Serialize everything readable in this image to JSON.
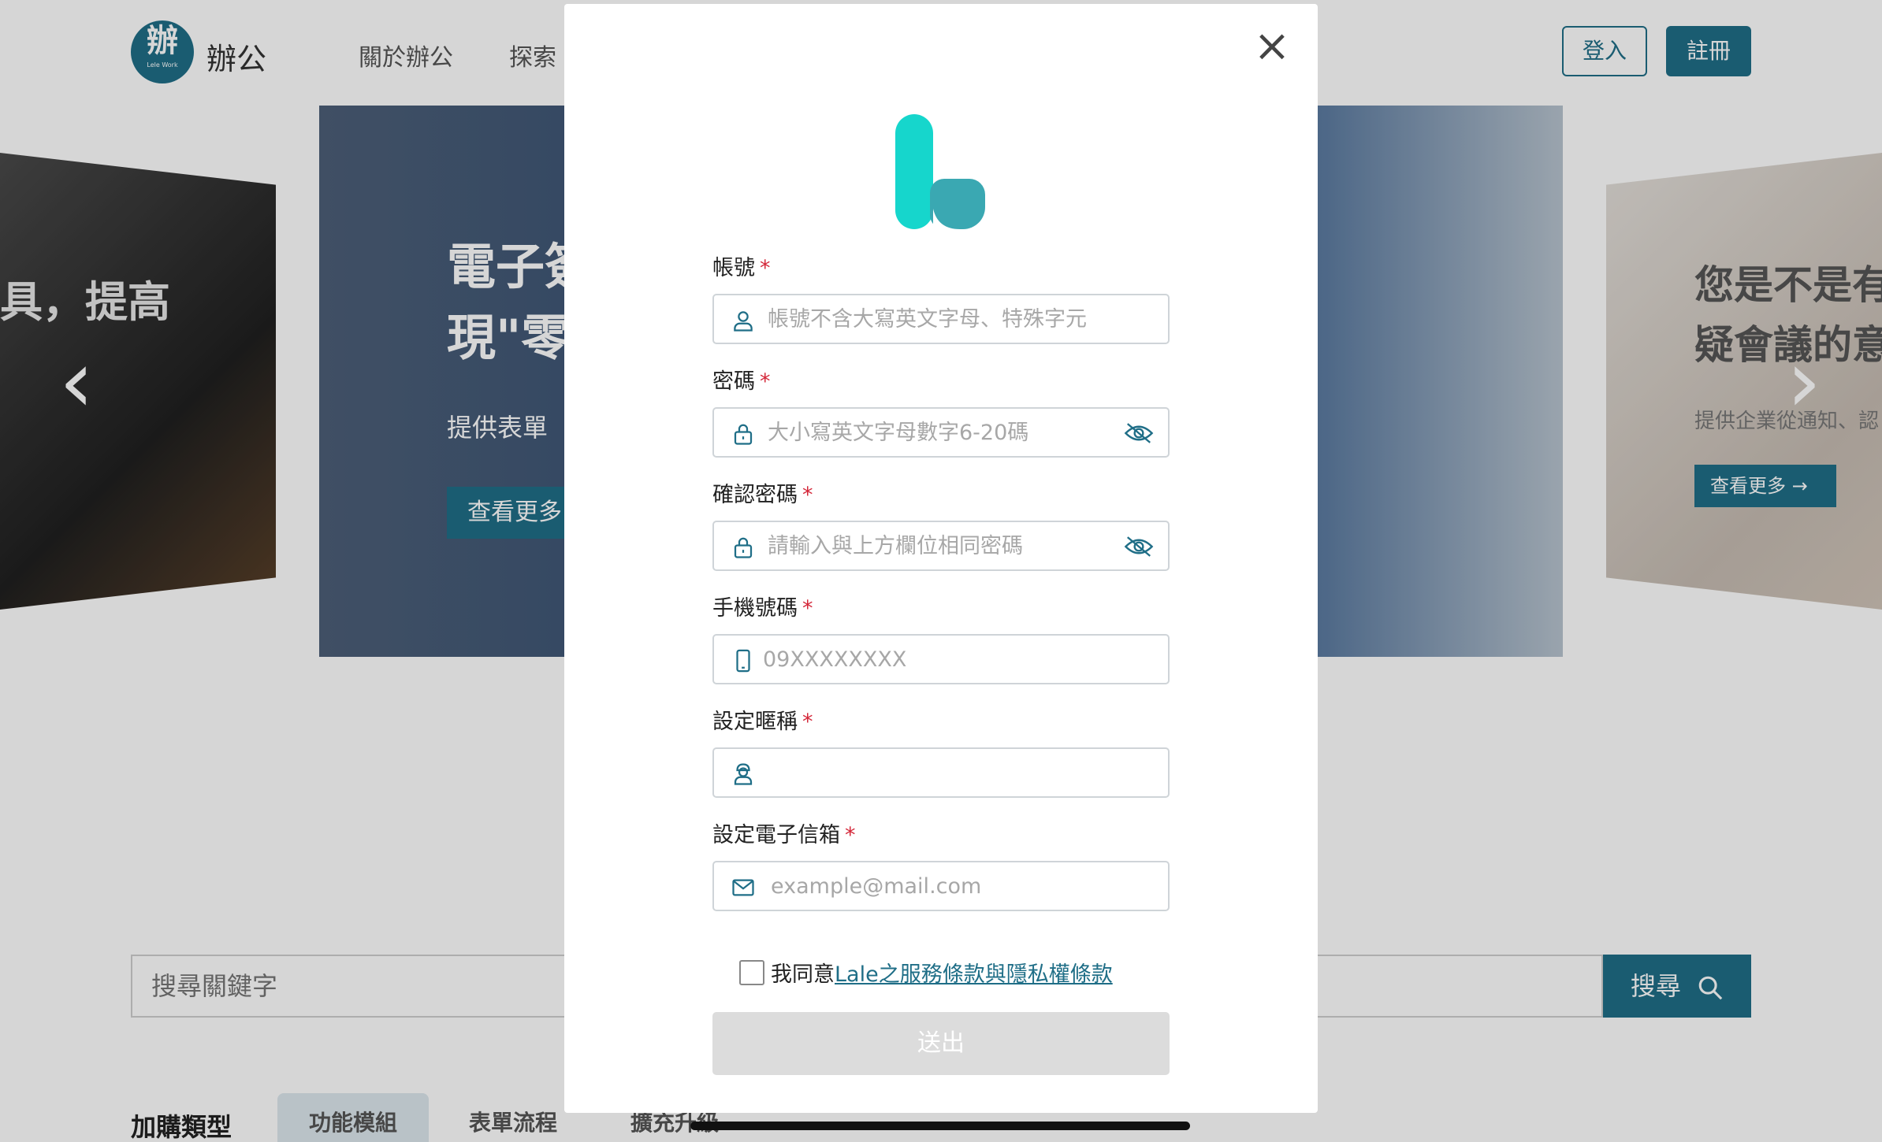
{
  "header": {
    "logo_glyph": "辦",
    "logo_sub": "Lele Work",
    "brand": "辦公",
    "nav": {
      "about": "關於辦公",
      "explore": "探索"
    },
    "login": "登入",
    "register": "註冊"
  },
  "carousel": {
    "left_title": "具，提高",
    "center_title": "電子簽\n現\"零",
    "center_desc": "提供表單",
    "center_button": "查看更多",
    "right_title": "您是不是有\n疑會議的意",
    "right_desc": "提供企業從通知、認",
    "right_button": "查看更多 →"
  },
  "search": {
    "placeholder": "搜尋關鍵字",
    "button": "搜尋"
  },
  "categories": {
    "label": "加購類型",
    "tabs": [
      "功能模組",
      "表單流程",
      "擴充升級"
    ],
    "active_index": 0
  },
  "modal": {
    "fields": {
      "account": {
        "label": "帳號",
        "required": "*",
        "placeholder": "帳號不含大寫英文字母、特殊字元",
        "icon": "user-icon"
      },
      "password": {
        "label": "密碼",
        "required": "*",
        "placeholder": "大小寫英文字母數字6-20碼",
        "icon": "lock-icon"
      },
      "confirm": {
        "label": "確認密碼",
        "required": "*",
        "placeholder": "請輸入與上方欄位相同密碼",
        "icon": "lock-icon"
      },
      "phone": {
        "label": "手機號碼",
        "required": "*",
        "placeholder": "09XXXXXXXX",
        "icon": "phone-icon"
      },
      "nickname": {
        "label": "設定暱稱",
        "required": "*",
        "placeholder": "",
        "icon": "avatar-icon"
      },
      "email": {
        "label": "設定電子信箱",
        "required": "*",
        "placeholder": "example@mail.com",
        "icon": "mail-icon"
      }
    },
    "agree_text": "我同意",
    "agree_link": "Lale之服務條款與隱私權條款",
    "submit": "送出"
  },
  "colors": {
    "brand": "#1f6e87",
    "logo_teal": "#16d6cc",
    "required": "#d4283a"
  }
}
